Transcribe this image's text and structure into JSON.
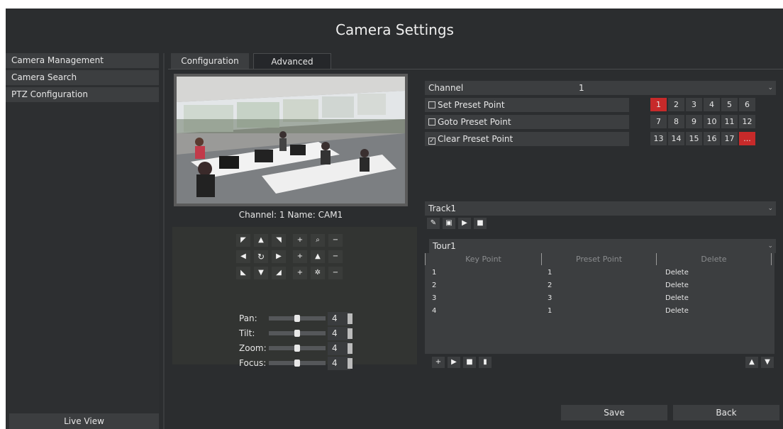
{
  "window": {
    "title": "Camera Settings"
  },
  "sidebar": {
    "items": [
      {
        "label": "Camera Management"
      },
      {
        "label": "Camera Search"
      },
      {
        "label": "PTZ Configuration"
      }
    ],
    "live_view_label": "Live View"
  },
  "tabs": [
    {
      "label": "Configuration",
      "active": false
    },
    {
      "label": "Advanced",
      "active": true
    }
  ],
  "preview": {
    "caption": "Channel: 1 Name: CAM1"
  },
  "ptz": {
    "sliders": [
      {
        "label": "Pan:",
        "value": "4",
        "level": 0.5
      },
      {
        "label": "Tilt:",
        "value": "4",
        "level": 0.5
      },
      {
        "label": "Zoom:",
        "value": "4",
        "level": 0.5
      },
      {
        "label": "Focus:",
        "value": "4",
        "level": 0.5
      }
    ]
  },
  "channel": {
    "label": "Channel",
    "value": "1"
  },
  "preset_actions": [
    {
      "label": "Set Preset Point",
      "checked": false
    },
    {
      "label": "Goto Preset Point",
      "checked": false
    },
    {
      "label": "Clear Preset Point",
      "checked": true
    }
  ],
  "presets": [
    "1",
    "2",
    "3",
    "4",
    "5",
    "6",
    "7",
    "8",
    "9",
    "10",
    "11",
    "12",
    "13",
    "14",
    "15",
    "16",
    "17",
    "..."
  ],
  "presets_selected": [
    "1",
    "..."
  ],
  "track": {
    "value": "Track1"
  },
  "tour": {
    "value": "Tour1",
    "columns": [
      "Key Point",
      "Preset Point",
      "Delete"
    ],
    "rows": [
      {
        "key": "1",
        "preset": "1",
        "action": "Delete"
      },
      {
        "key": "2",
        "preset": "2",
        "action": "Delete"
      },
      {
        "key": "3",
        "preset": "3",
        "action": "Delete"
      },
      {
        "key": "4",
        "preset": "1",
        "action": "Delete"
      }
    ]
  },
  "footer": {
    "save_label": "Save",
    "back_label": "Back"
  },
  "colors": {
    "accent": "#c72a2a",
    "background": "#2b2d2f",
    "panel": "#3c3e40"
  }
}
